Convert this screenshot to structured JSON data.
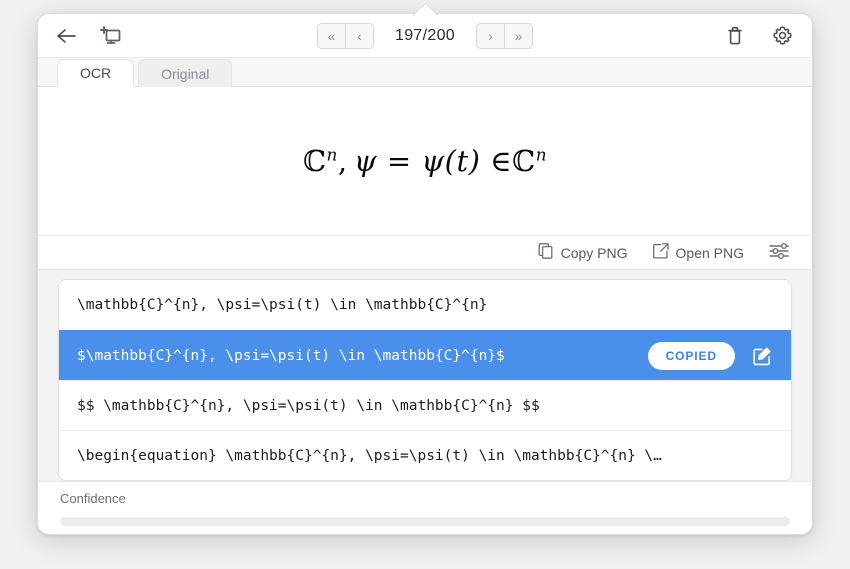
{
  "window": {
    "toolbar": {
      "back_icon": "back-arrow-icon",
      "capture_icon": "new-screenshot-icon",
      "first_label": "«",
      "prev_label": "‹",
      "counter": "197/200",
      "next_label": "›",
      "last_label": "»",
      "trash_icon": "trash-icon",
      "settings_icon": "gear-icon"
    },
    "tabs": [
      {
        "label": "OCR",
        "active": true
      },
      {
        "label": "Original",
        "active": false
      }
    ],
    "preview": {
      "rendered_math_plain": "ℂ^n, ψ = ψ(t) ∈ℂ^n",
      "part_c1": "ℂ",
      "sup_n1": "n",
      "comma": ",",
      "psi1": "ψ",
      "equals": "=",
      "psi2": "ψ",
      "paren_t": "(t)",
      "in_symbol": "∈",
      "part_c2": "ℂ",
      "sup_n2": "n"
    },
    "actionbar": {
      "copy_png_label": "Copy PNG",
      "copy_png_icon": "copy-icon",
      "open_png_label": "Open PNG",
      "open_png_icon": "external-link-icon",
      "tune_icon": "sliders-icon"
    },
    "results": [
      {
        "text": "\\mathbb{C}^{n}, \\psi=\\psi(t) \\in \\mathbb{C}^{n}",
        "selected": false
      },
      {
        "text": "$\\mathbb{C}^{n}, \\psi=\\psi(t) \\in \\mathbb{C}^{n}$",
        "selected": true,
        "badge": "COPIED",
        "edit_icon": "edit-square-icon"
      },
      {
        "text": "$$ \\mathbb{C}^{n}, \\psi=\\psi(t) \\in \\mathbb{C}^{n} $$",
        "selected": false
      },
      {
        "text": "\\begin{equation} \\mathbb{C}^{n}, \\psi=\\psi(t) \\in \\mathbb{C}^{n} \\…",
        "selected": false
      }
    ],
    "confidence": {
      "label": "Confidence",
      "percent": 0
    }
  }
}
